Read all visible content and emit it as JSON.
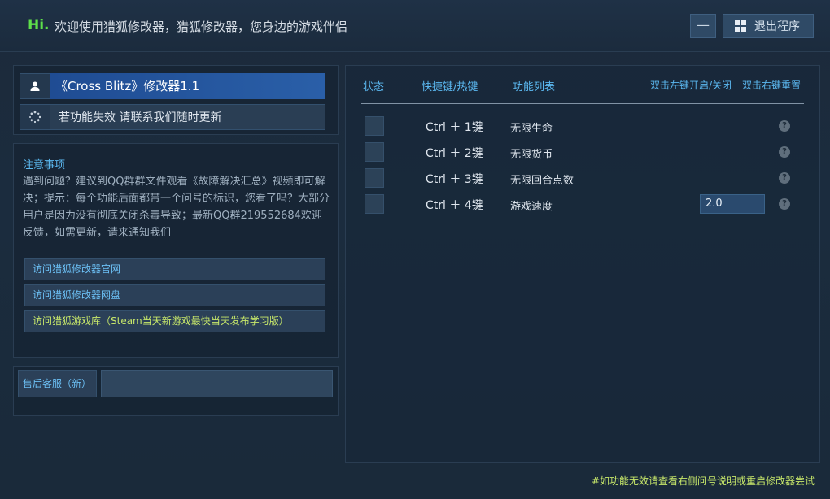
{
  "header": {
    "hi": "Hi.",
    "welcome": "欢迎使用猎狐修改器，猎狐修改器，您身边的游戏伴侣",
    "minimize_label": "—",
    "exit_label": "退出程序"
  },
  "left": {
    "game_title": "《Cross Blitz》修改器1.1",
    "notice": "若功能失效  请联系我们随时更新",
    "note_title": "注意事项",
    "note_body": "遇到问题？建议到QQ群群文件观看《故障解决汇总》视频即可解决；提示：每个功能后面都带一个问号的标识，您看了吗？大部分用户是因为没有彻底关闭杀毒导致；最新QQ群219552684欢迎反馈，如需更新，请来通知我们",
    "links": [
      "访问猎狐修改器官网",
      "访问猎狐修改器网盘",
      "访问猎狐游戏库（Steam当天新游戏最快当天发布学习版）"
    ],
    "service_label": "售后客服（新）"
  },
  "table": {
    "headers": {
      "state": "状态",
      "hotkey": "快捷键/热键",
      "features": "功能列表",
      "toggle_hint": "双击左键开启/关闭",
      "reset_hint": "双击右键重置"
    },
    "rows": [
      {
        "hotkey": "Ctrl ＋ 1键",
        "feature": "无限生命"
      },
      {
        "hotkey": "Ctrl ＋ 2键",
        "feature": "无限货币"
      },
      {
        "hotkey": "Ctrl ＋ 3键",
        "feature": "无限回合点数"
      },
      {
        "hotkey": "Ctrl ＋ 4键",
        "feature": "游戏速度",
        "input_value": "2.0"
      }
    ],
    "help_glyph": "?"
  },
  "footer": "#如功能无效请查看右侧问号说明或重启修改器尝试",
  "icons": {
    "user": "user-icon",
    "loading": "loading-icon",
    "windows": "windows-icon",
    "help": "help-icon"
  }
}
